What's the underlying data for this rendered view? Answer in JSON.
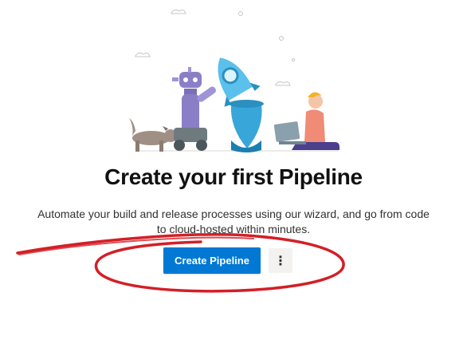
{
  "empty_state": {
    "title": "Create your first Pipeline",
    "description": "Automate your build and release processes using our wizard, and go from code to cloud-hosted within minutes.",
    "primary_button_label": "Create Pipeline",
    "more_options_glyph": "⋮",
    "illustration_icon": "robot-rocket-dog-developer-illustration"
  },
  "colors": {
    "primary": "#0078d4",
    "annotation_ink": "#d31f27"
  }
}
